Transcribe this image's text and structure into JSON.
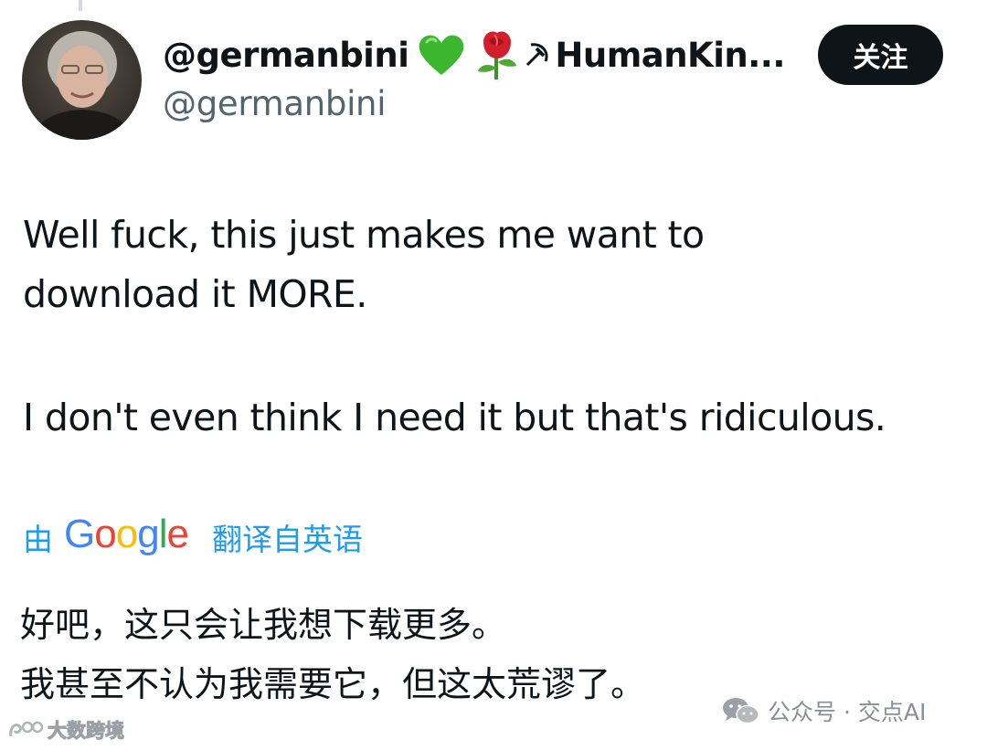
{
  "author": {
    "display_name": "@germanbini",
    "name_tail": "HumanKin...",
    "handle": "@germanbini",
    "emoji_icons": [
      "green-heart-icon",
      "rose-icon",
      "hammer-sickle-icon"
    ]
  },
  "follow_button": {
    "label": "关注"
  },
  "tweet": {
    "lines": [
      "Well fuck, this just makes me want to",
      "download it MORE.",
      "I don't even think I need it but that's ridiculous."
    ]
  },
  "translation": {
    "by_label": "由",
    "logo_text": "Google",
    "action_label": "翻译自英语",
    "lines": [
      "好吧，这只会让我想下载更多。",
      "我甚至不认为我需要它，但这太荒谬了。"
    ]
  },
  "watermarks": {
    "right": "公众号 · 交点AI",
    "left": "大数跨境"
  },
  "colors": {
    "link_blue": "#1d9bf0",
    "secondary_text": "#536471",
    "button_bg": "#0f1419",
    "google_blue": "#4285F4",
    "google_red": "#EA4335",
    "google_yellow": "#FBBC05",
    "google_green": "#34A853"
  }
}
